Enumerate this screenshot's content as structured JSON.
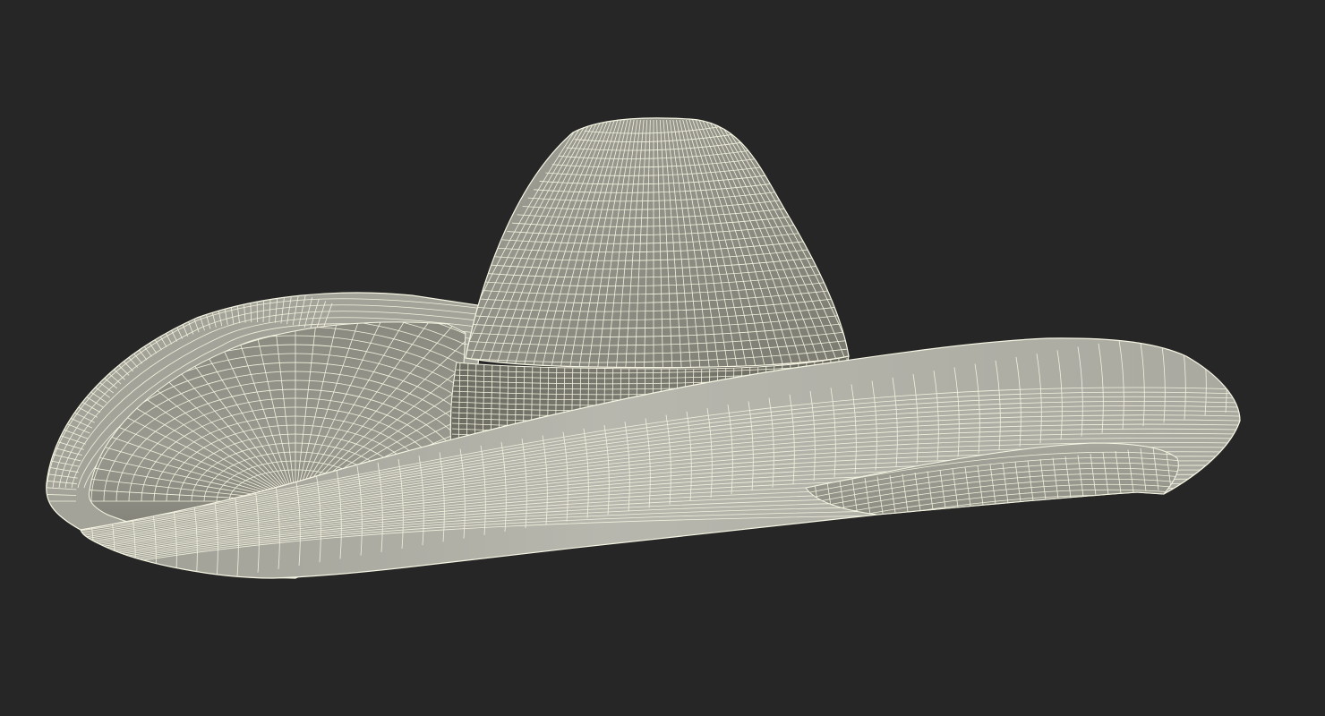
{
  "viewport": {
    "background_color": "#262626",
    "shade_far": "#6b6b60",
    "shade_mid": "#8d8d83",
    "shade_light": "#b6b6ad",
    "wire_color": "#f7f6e4",
    "subject": "sombrero-hat-wireframe"
  }
}
